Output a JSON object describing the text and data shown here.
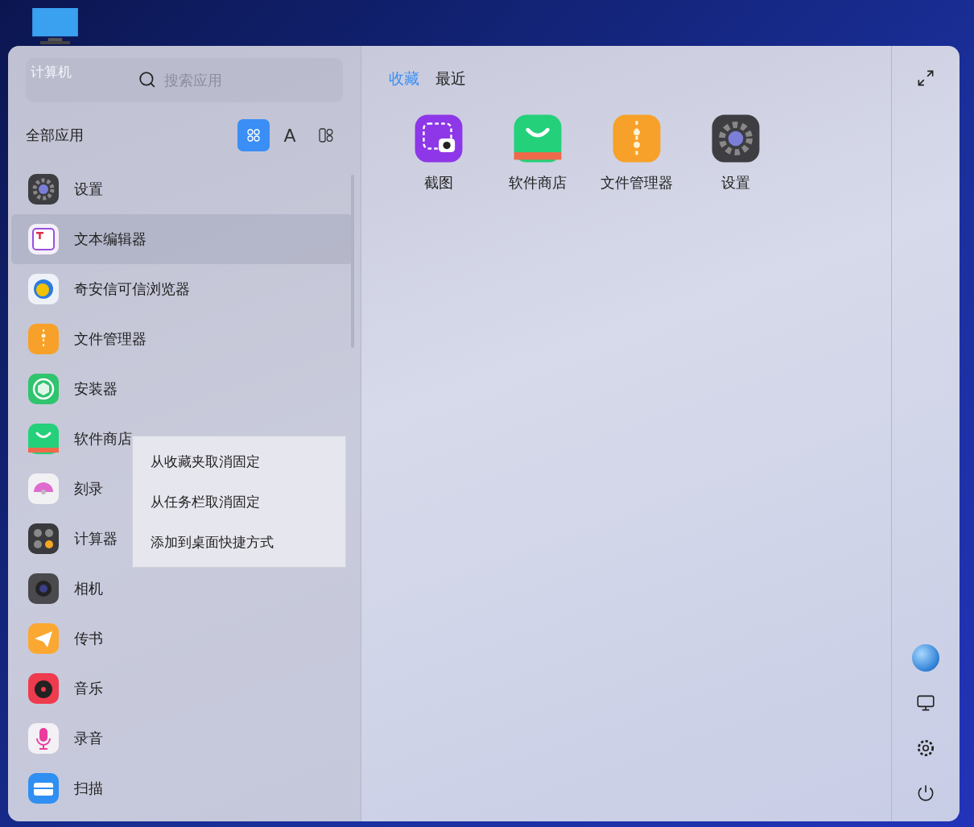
{
  "desktop": {
    "icons": [
      {
        "label": "计算机"
      }
    ]
  },
  "search": {
    "placeholder": "搜索应用"
  },
  "app_list": {
    "title": "全部应用",
    "view_modes": [
      {
        "kind": "grid",
        "selected": true
      },
      {
        "kind": "letter",
        "label": "A",
        "selected": false
      },
      {
        "kind": "category",
        "selected": false
      }
    ],
    "items": [
      {
        "name": "设置",
        "kind": "settings",
        "selected": false
      },
      {
        "name": "文本编辑器",
        "kind": "text-editor",
        "selected": true
      },
      {
        "name": "奇安信可信浏览器",
        "kind": "browser",
        "selected": false
      },
      {
        "name": "文件管理器",
        "kind": "files",
        "selected": false
      },
      {
        "name": "安装器",
        "kind": "installer",
        "selected": false
      },
      {
        "name": "软件商店",
        "kind": "store",
        "selected": false
      },
      {
        "name": "刻录",
        "kind": "burner",
        "selected": false
      },
      {
        "name": "计算器",
        "kind": "calculator",
        "selected": false
      },
      {
        "name": "相机",
        "kind": "camera",
        "selected": false
      },
      {
        "name": "传书",
        "kind": "messenger",
        "selected": false
      },
      {
        "name": "音乐",
        "kind": "music",
        "selected": false
      },
      {
        "name": "录音",
        "kind": "recorder",
        "selected": false
      },
      {
        "name": "扫描",
        "kind": "scanner",
        "selected": false
      }
    ]
  },
  "context_menu": {
    "items": [
      "从收藏夹取消固定",
      "从任务栏取消固定",
      "添加到桌面快捷方式"
    ]
  },
  "tabs": [
    {
      "label": "收藏",
      "selected": true
    },
    {
      "label": "最近",
      "selected": false
    }
  ],
  "favorites": [
    {
      "name": "截图",
      "kind": "screenshot"
    },
    {
      "name": "软件商店",
      "kind": "store"
    },
    {
      "name": "文件管理器",
      "kind": "files"
    },
    {
      "name": "设置",
      "kind": "settings"
    }
  ]
}
